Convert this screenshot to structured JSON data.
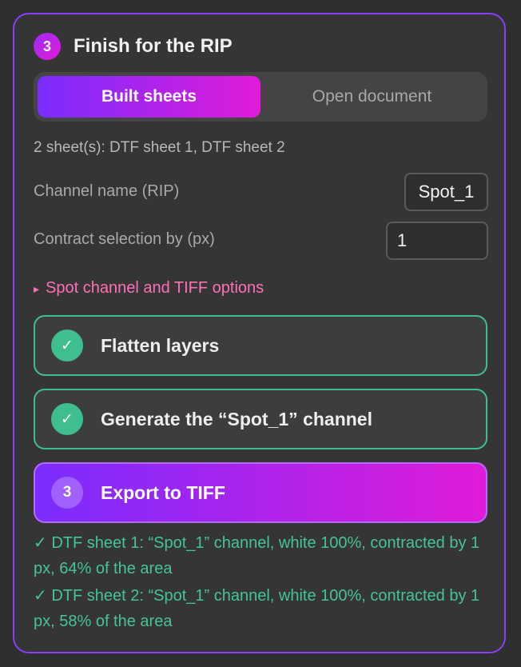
{
  "header": {
    "step_number": "3",
    "title": "Finish for the RIP"
  },
  "tabs": [
    {
      "label": "Built sheets",
      "active": true
    },
    {
      "label": "Open document",
      "active": false
    }
  ],
  "sheets_summary": "2 sheet(s): DTF sheet 1, DTF sheet 2",
  "fields": {
    "channel_name": {
      "label": "Channel name (RIP)",
      "value": "Spot_1"
    },
    "contract_by": {
      "label": "Contract selection by (px)",
      "value": "1"
    }
  },
  "options_toggle": {
    "caret": "▸",
    "label": "Spot channel and TIFF options"
  },
  "steps": [
    {
      "badge": "✓",
      "label": "Flatten layers",
      "state": "done"
    },
    {
      "badge": "✓",
      "label": "Generate the “Spot_1” channel",
      "state": "done"
    },
    {
      "badge": "3",
      "label": "Export to TIFF",
      "state": "current"
    }
  ],
  "results": [
    "✓ DTF sheet 1: “Spot_1” channel, white 100%, contracted by 1 px, 64% of the area",
    "✓ DTF sheet 2: “Spot_1” channel, white 100%, contracted by 1 px, 58% of the area"
  ],
  "colors": {
    "accent_purple": "#7a2cff",
    "accent_magenta": "#e01bd8",
    "success_green": "#3fbf8f",
    "link_pink": "#ff6fb8",
    "panel_border": "#8a3ffc"
  }
}
